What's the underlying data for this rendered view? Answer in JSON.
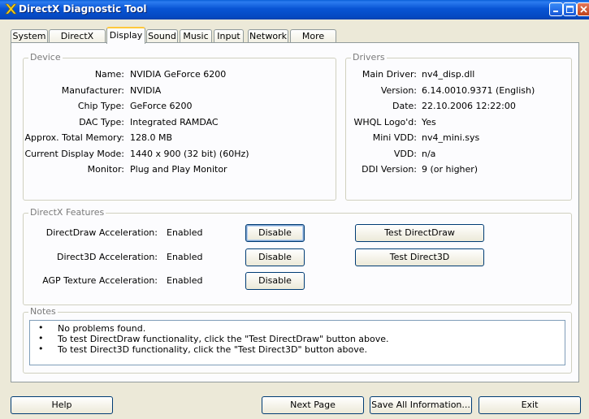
{
  "window": {
    "title": "DirectX Diagnostic Tool",
    "icon": "directx-x-icon"
  },
  "tabs": [
    {
      "label": "System",
      "active": false
    },
    {
      "label": "DirectX Files",
      "active": false
    },
    {
      "label": "Display",
      "active": true
    },
    {
      "label": "Sound",
      "active": false
    },
    {
      "label": "Music",
      "active": false
    },
    {
      "label": "Input",
      "active": false
    },
    {
      "label": "Network",
      "active": false
    },
    {
      "label": "More Help",
      "active": false
    }
  ],
  "device": {
    "legend": "Device",
    "rows": [
      {
        "label": "Name:",
        "value": "NVIDIA GeForce 6200"
      },
      {
        "label": "Manufacturer:",
        "value": "NVIDIA"
      },
      {
        "label": "Chip Type:",
        "value": "GeForce 6200"
      },
      {
        "label": "DAC Type:",
        "value": "Integrated RAMDAC"
      },
      {
        "label": "Approx. Total Memory:",
        "value": "128.0 MB"
      },
      {
        "label": "Current Display Mode:",
        "value": "1440 x 900 (32 bit) (60Hz)"
      },
      {
        "label": "Monitor:",
        "value": "Plug and Play Monitor"
      }
    ]
  },
  "drivers": {
    "legend": "Drivers",
    "rows": [
      {
        "label": "Main Driver:",
        "value": "nv4_disp.dll"
      },
      {
        "label": "Version:",
        "value": "6.14.0010.9371 (English)"
      },
      {
        "label": "Date:",
        "value": "22.10.2006 12:22:00"
      },
      {
        "label": "WHQL Logo'd:",
        "value": "Yes"
      },
      {
        "label": "Mini VDD:",
        "value": "nv4_mini.sys"
      },
      {
        "label": "VDD:",
        "value": "n/a"
      },
      {
        "label": "DDI Version:",
        "value": "9 (or higher)"
      }
    ]
  },
  "features": {
    "legend": "DirectX Features",
    "rows": [
      {
        "label": "DirectDraw Acceleration:",
        "status": "Enabled",
        "button": "Disable",
        "test": "Test DirectDraw"
      },
      {
        "label": "Direct3D Acceleration:",
        "status": "Enabled",
        "button": "Disable",
        "test": "Test Direct3D"
      },
      {
        "label": "AGP Texture Acceleration:",
        "status": "Enabled",
        "button": "Disable"
      }
    ]
  },
  "notes": {
    "legend": "Notes",
    "bullet": "•",
    "items": [
      "No problems found.",
      "To test DirectDraw functionality, click the \"Test DirectDraw\" button above.",
      "To test Direct3D functionality, click the \"Test Direct3D\" button above."
    ]
  },
  "footer": {
    "help": "Help",
    "next_page": "Next Page",
    "save_all": "Save All Information...",
    "exit": "Exit"
  }
}
